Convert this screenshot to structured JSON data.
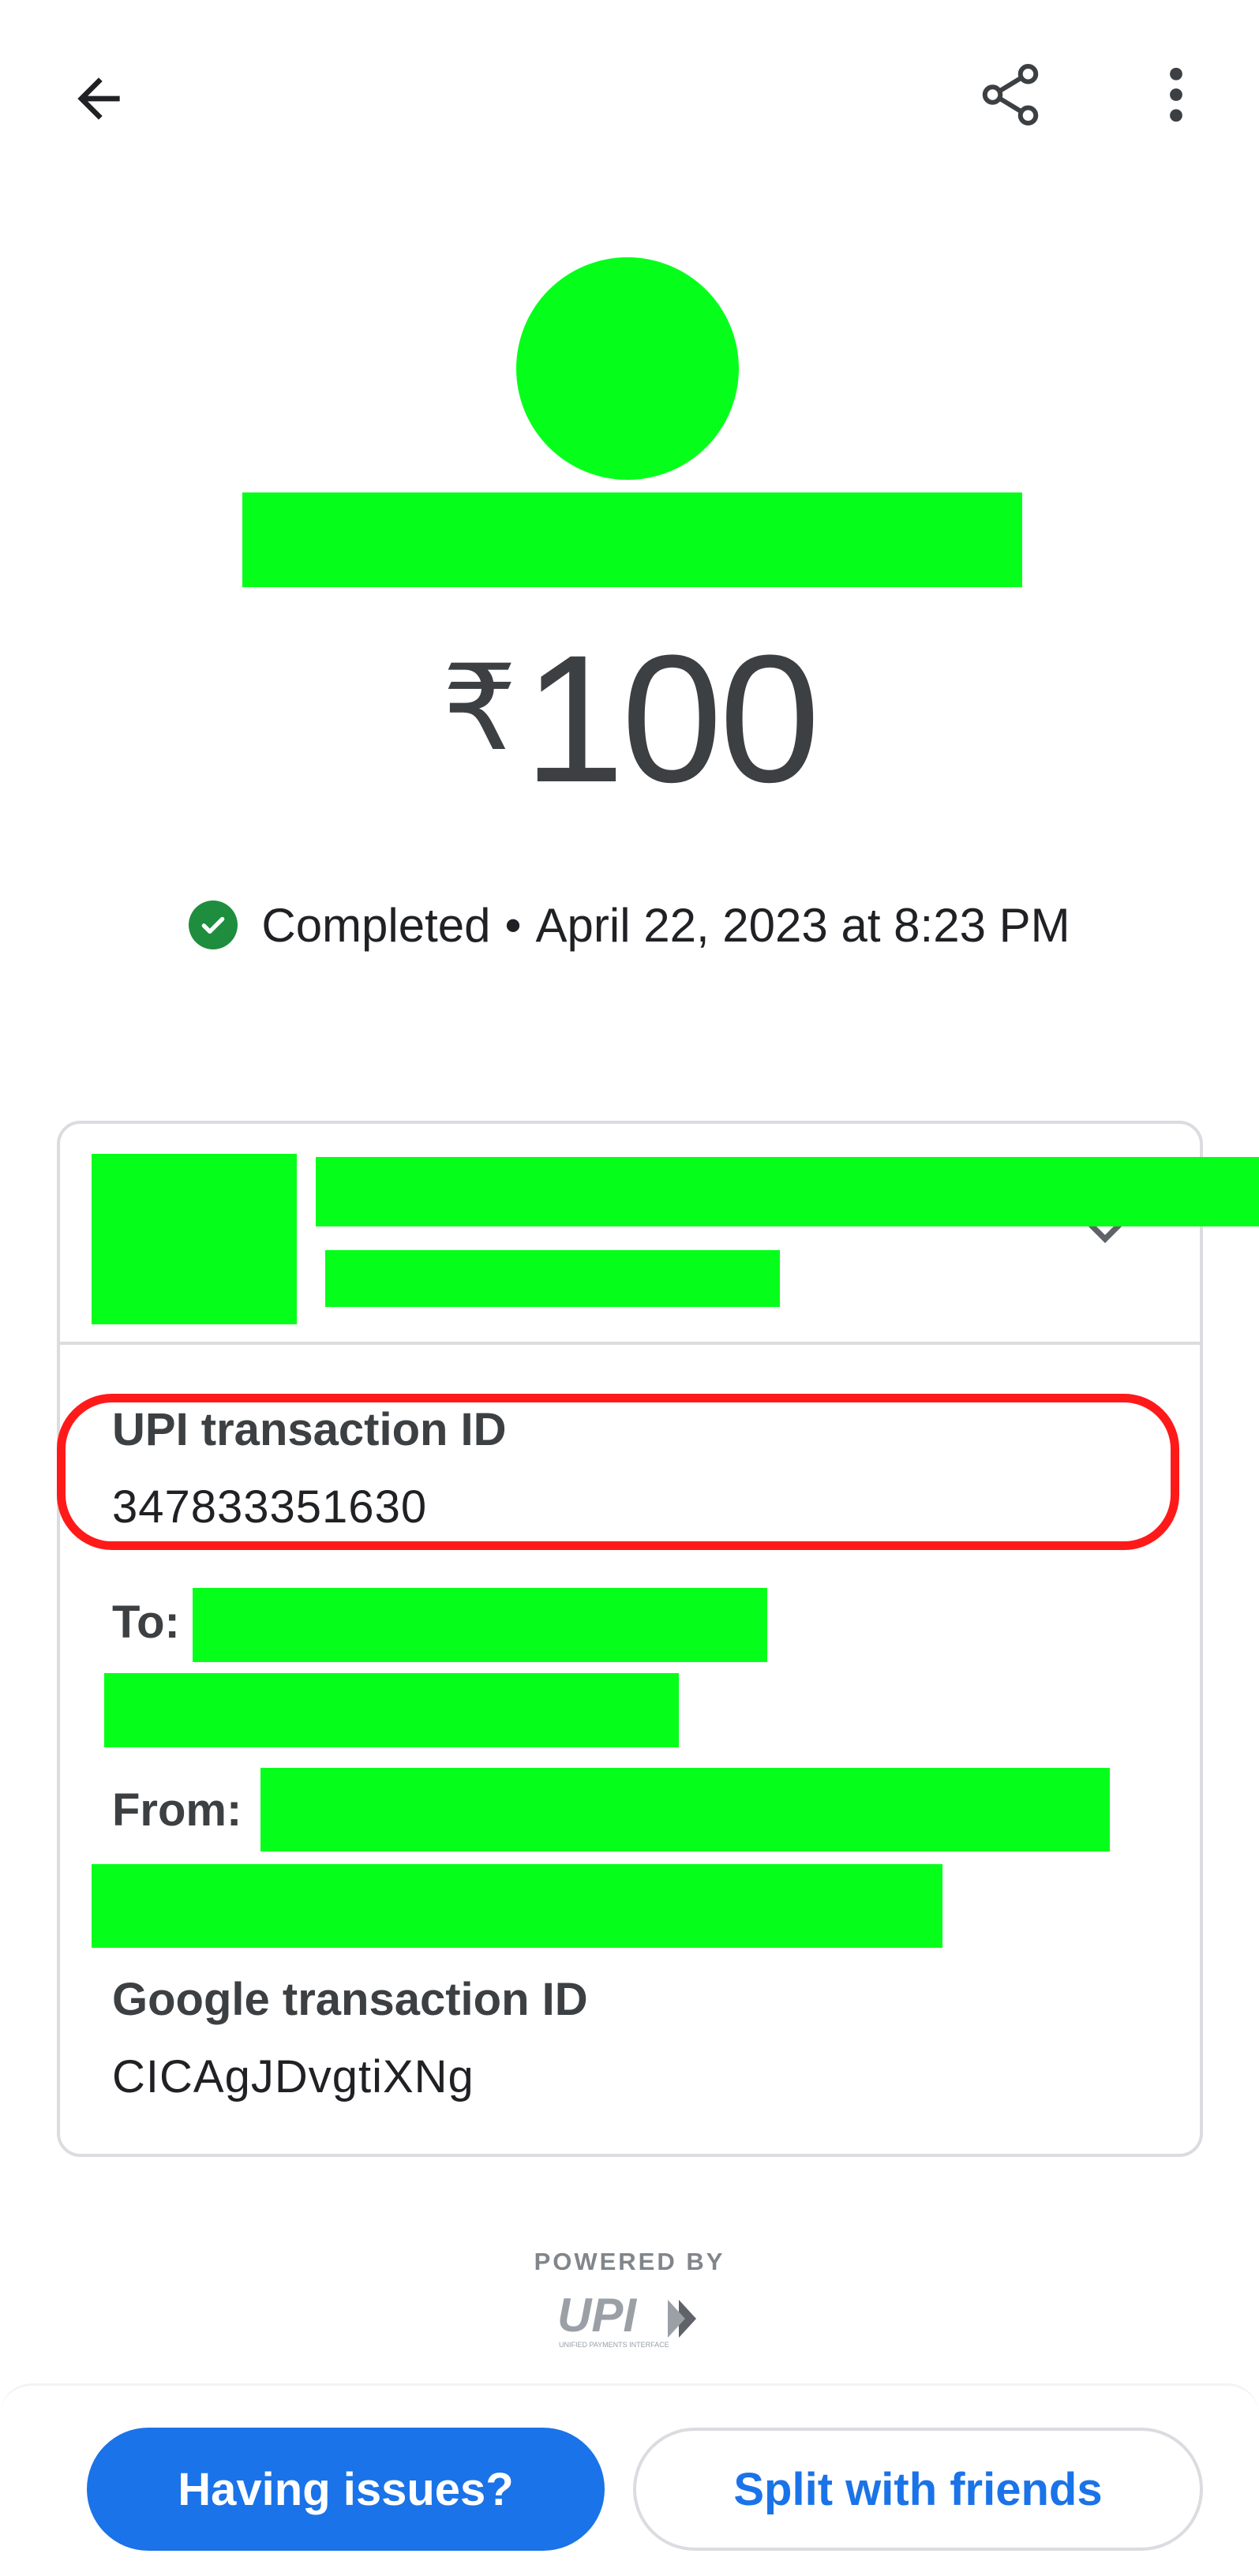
{
  "header": {
    "back_icon": "arrow-left-icon",
    "share_icon": "share-icon",
    "more_icon": "more-vert-icon"
  },
  "payment": {
    "currency_symbol": "₹",
    "amount": "100",
    "status_icon": "check-circle-icon",
    "status": "Completed",
    "separator": "•",
    "datetime": "April 22, 2023 at 8:23 PM"
  },
  "details": {
    "expand_icon": "chevron-down-icon",
    "upi_label": "UPI transaction ID",
    "upi_value": "347833351630",
    "to_label": "To:",
    "from_label": "From:",
    "google_label": "Google transaction ID",
    "google_value": "CICAgJDvgtiXNg"
  },
  "footer": {
    "powered_by": "POWERED BY",
    "logo_text": "UPI",
    "logo_subtext": "UNIFIED PAYMENTS INTERFACE"
  },
  "actions": {
    "issues_label": "Having issues?",
    "split_label": "Split with friends"
  },
  "colors": {
    "accent": "#1a73e8",
    "success": "#1e8e3e",
    "highlight": "#ff1a1a",
    "redaction": "#06ff1a"
  }
}
